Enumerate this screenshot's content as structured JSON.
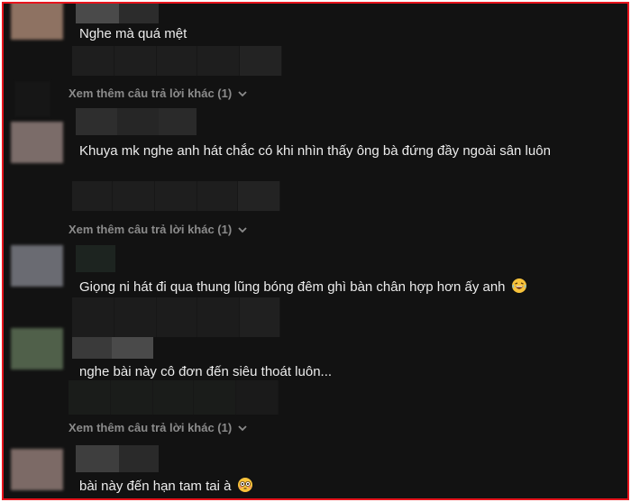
{
  "comments": [
    {
      "text": "Nghe mà quá mệt",
      "avatar_color": "#8e7262"
    },
    {
      "text": "Khuya mk nghe anh hát chắc có khi nhìn thấy ông bà đứng đầy ngoài sân luôn",
      "avatar_color": "#7b6c69"
    },
    {
      "text": "Giọng ni hát đi qua thung lũng bóng đêm ghì bàn chân hợp hơn ấy anh",
      "emoji": "laughing-emoji",
      "avatar_color": "#6a6b72"
    },
    {
      "text": "nghe bài này cô đơn đến siêu thoát luôn...",
      "avatar_color": "#50604a"
    },
    {
      "text": "bài này đến hạn tam tai à",
      "emoji": "flushed-emoji",
      "avatar_color": "#7c6a66"
    }
  ],
  "more_replies": [
    {
      "label": "Xem thêm câu trả lời khác (1)",
      "icon": "chevron-down-icon"
    },
    {
      "label": "Xem thêm câu trả lời khác (1)",
      "icon": "chevron-down-icon"
    },
    {
      "label": "Xem thêm câu trả lời khác (1)",
      "icon": "chevron-down-icon"
    }
  ],
  "colors": {
    "background": "#121212",
    "frame_border": "#e8141c",
    "text": "#ececec",
    "muted": "#8b8b8b"
  }
}
